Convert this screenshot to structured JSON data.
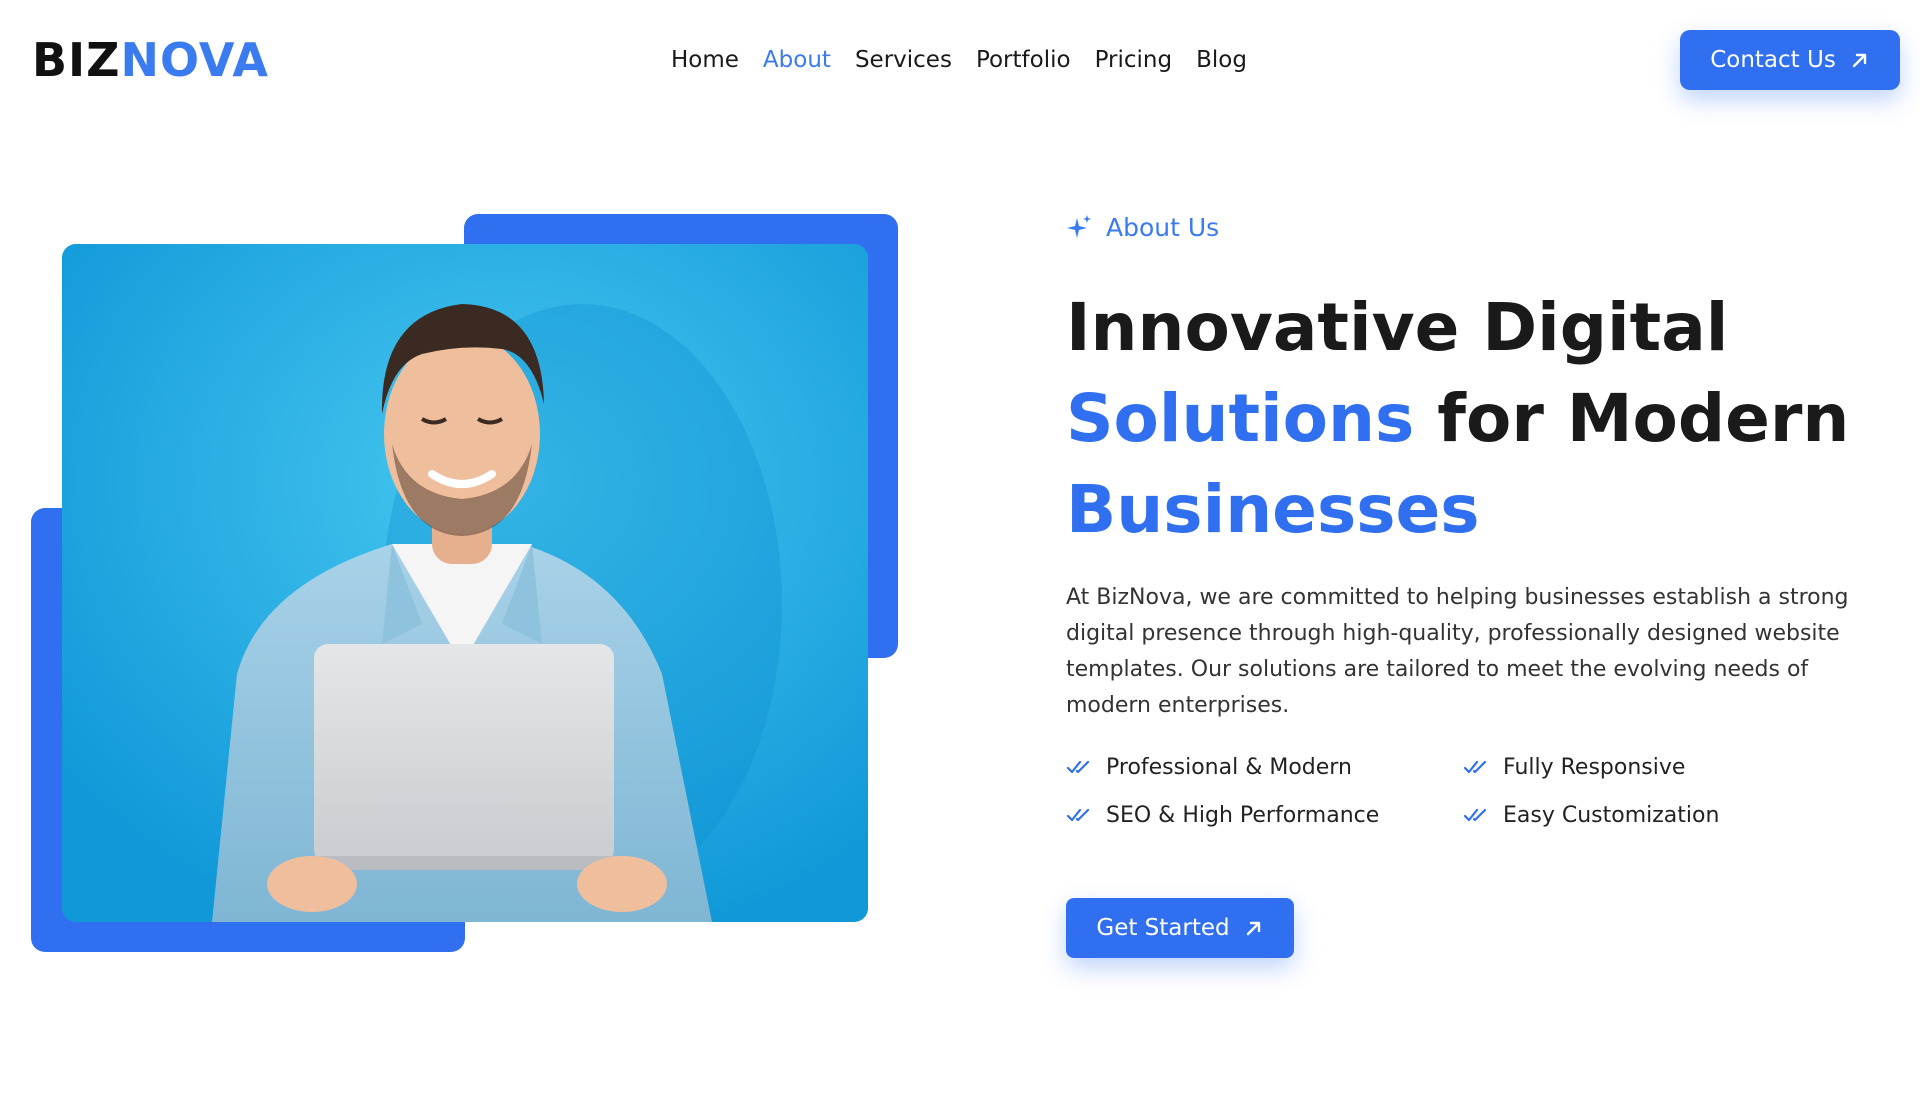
{
  "brand": {
    "logo_part1": "BIZ",
    "logo_part2": "NOVA"
  },
  "nav": {
    "items": [
      {
        "label": "Home",
        "active": false
      },
      {
        "label": "About",
        "active": true
      },
      {
        "label": "Services",
        "active": false
      },
      {
        "label": "Portfolio",
        "active": false
      },
      {
        "label": "Pricing",
        "active": false
      },
      {
        "label": "Blog",
        "active": false
      }
    ]
  },
  "header": {
    "contact_label": "Contact Us",
    "contact_icon": "arrow-up-right-icon"
  },
  "hero_image": {
    "subject": "man-with-laptop-photo"
  },
  "about": {
    "eyebrow": "About Us",
    "eyebrow_icon": "sparkle-icon",
    "headline": {
      "line1": "Innovative Digital",
      "line2_blue": "Solutions",
      "line2_rest": " for Modern",
      "line3_blue": "Businesses"
    },
    "description": "At BizNova, we are committed to helping businesses establish a strong digital presence through high-quality, professionally designed website templates. Our solutions are tailored to meet the evolving needs of modern enterprises.",
    "features": [
      "Professional & Modern",
      "Fully Responsive",
      "SEO & High Performance",
      "Easy Customization"
    ],
    "feature_icon": "double-check-icon",
    "cta_label": "Get Started",
    "cta_icon": "arrow-up-right-icon"
  },
  "colors": {
    "accent": "#2f6ff0",
    "accent_light": "#3a7bf0",
    "photo_bg": "#20a9e4",
    "text": "#1a1a1a"
  }
}
